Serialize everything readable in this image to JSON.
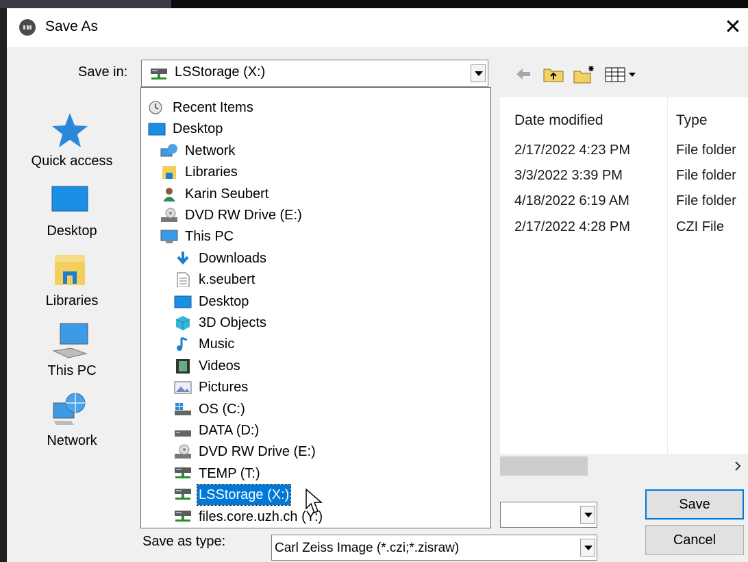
{
  "dialog": {
    "title": "Save As"
  },
  "save_in": {
    "label": "Save in:",
    "value": "LSStorage (X:)"
  },
  "sidebar": {
    "items": [
      {
        "label": "Quick access",
        "icon": "star-icon"
      },
      {
        "label": "Desktop",
        "icon": "desktop-icon"
      },
      {
        "label": "Libraries",
        "icon": "libraries-icon"
      },
      {
        "label": "This PC",
        "icon": "this-pc-icon"
      },
      {
        "label": "Network",
        "icon": "network-icon"
      }
    ]
  },
  "file_list": {
    "columns": [
      "Date modified",
      "Type"
    ],
    "rows": [
      {
        "date": "2/17/2022 4:23 PM",
        "type": "File folder"
      },
      {
        "date": "3/3/2022 3:39 PM",
        "type": "File folder"
      },
      {
        "date": "4/18/2022 6:19 AM",
        "type": "File folder"
      },
      {
        "date": "2/17/2022 4:28 PM",
        "type": "CZI File"
      }
    ]
  },
  "location_dropdown": {
    "items": [
      {
        "label": "Recent Items",
        "level": 0,
        "icon": "recent-items-icon"
      },
      {
        "label": "Desktop",
        "level": 0,
        "icon": "desktop-icon"
      },
      {
        "label": "Network",
        "level": 1,
        "icon": "network-icon"
      },
      {
        "label": "Libraries",
        "level": 1,
        "icon": "libraries-icon"
      },
      {
        "label": "Karin Seubert",
        "level": 1,
        "icon": "user-icon"
      },
      {
        "label": "DVD RW Drive (E:)",
        "level": 1,
        "icon": "dvd-drive-icon"
      },
      {
        "label": "This PC",
        "level": 1,
        "icon": "this-pc-icon"
      },
      {
        "label": "Downloads",
        "level": 2,
        "icon": "downloads-icon"
      },
      {
        "label": "k.seubert",
        "level": 2,
        "icon": "document-icon"
      },
      {
        "label": "Desktop",
        "level": 2,
        "icon": "desktop-icon"
      },
      {
        "label": "3D Objects",
        "level": 2,
        "icon": "3d-objects-icon"
      },
      {
        "label": "Music",
        "level": 2,
        "icon": "music-icon"
      },
      {
        "label": "Videos",
        "level": 2,
        "icon": "videos-icon"
      },
      {
        "label": "Pictures",
        "level": 2,
        "icon": "pictures-icon"
      },
      {
        "label": "OS (C:)",
        "level": 2,
        "icon": "os-drive-icon"
      },
      {
        "label": "DATA (D:)",
        "level": 2,
        "icon": "drive-icon"
      },
      {
        "label": "DVD RW Drive (E:)",
        "level": 2,
        "icon": "dvd-drive-icon"
      },
      {
        "label": "TEMP (T:)",
        "level": 2,
        "icon": "network-drive-icon"
      },
      {
        "label": "LSStorage (X:)",
        "level": 2,
        "icon": "network-drive-icon",
        "selected": true
      },
      {
        "label": "files.core.uzh.ch (Y:)",
        "level": 2,
        "icon": "network-drive-icon"
      }
    ]
  },
  "save_as_type": {
    "label": "Save as type:",
    "value": "Carl Zeiss Image (*.czi;*.zisraw)"
  },
  "buttons": {
    "save": "Save",
    "cancel": "Cancel"
  },
  "colors": {
    "selection": "#0078d7",
    "dialog_bg": "#f0f0f0"
  }
}
